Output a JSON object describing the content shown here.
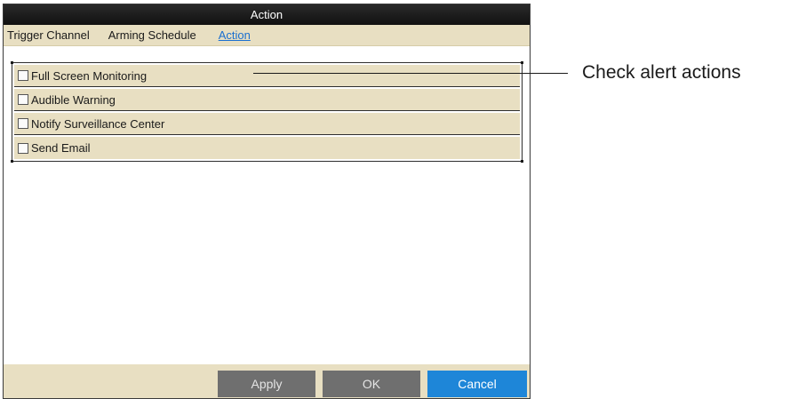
{
  "dialog": {
    "title": "Action",
    "tabs": [
      {
        "label": "Trigger Channel",
        "active": false
      },
      {
        "label": "Arming Schedule",
        "active": false
      },
      {
        "label": "Action",
        "active": true
      }
    ],
    "actions": [
      {
        "label": "Full Screen Monitoring",
        "checked": false
      },
      {
        "label": "Audible Warning",
        "checked": false
      },
      {
        "label": "Notify Surveillance Center",
        "checked": false
      },
      {
        "label": "Send Email",
        "checked": false
      }
    ],
    "buttons": {
      "apply": "Apply",
      "ok": "OK",
      "cancel": "Cancel"
    }
  },
  "callout": {
    "text": "Check alert actions"
  },
  "colors": {
    "accent": "#1e86d8",
    "panel": "#e8dfc2",
    "titlebar": "#111111"
  }
}
